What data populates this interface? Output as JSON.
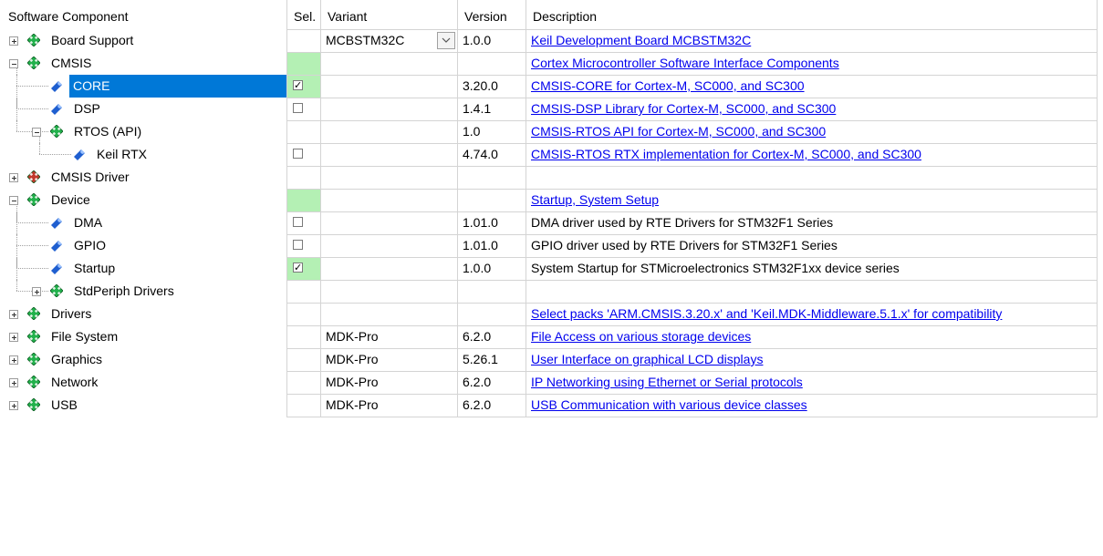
{
  "headers": {
    "component": "Software Component",
    "sel": "Sel.",
    "variant": "Variant",
    "version": "Version",
    "description": "Description"
  },
  "colors": {
    "selection": "#0078d7",
    "sel_highlight": "#b4f0b4",
    "link": "#0000ee",
    "diamond_ok": "#22b14c",
    "diamond_error": "#c0392b",
    "gem": "#1f5fd0"
  },
  "rows": [
    {
      "name": "Board Support",
      "level": 0,
      "expander": "plus",
      "icon": "green-diamond-icon",
      "checkbox": null,
      "sel_green": false,
      "variant": "MCBSTM32C",
      "variant_dropdown": true,
      "version": "1.0.0",
      "description": "Keil Development Board MCBSTM32C",
      "desc_link": true,
      "selected": false
    },
    {
      "name": "CMSIS",
      "level": 0,
      "expander": "minus",
      "icon": "green-diamond-icon",
      "checkbox": null,
      "sel_green": true,
      "variant": "",
      "variant_dropdown": false,
      "version": "",
      "description": "Cortex Microcontroller Software Interface Components",
      "desc_link": true,
      "selected": false
    },
    {
      "name": "CORE",
      "level": 1,
      "expander": "none",
      "icon": "blue-gem-icon",
      "checkbox": "checked",
      "sel_green": true,
      "variant": "",
      "variant_dropdown": false,
      "version": "3.20.0",
      "description": "CMSIS-CORE for Cortex-M, SC000, and SC300",
      "desc_link": true,
      "selected": true
    },
    {
      "name": "DSP",
      "level": 1,
      "expander": "none",
      "icon": "blue-gem-icon",
      "checkbox": "unchecked",
      "sel_green": false,
      "variant": "",
      "variant_dropdown": false,
      "version": "1.4.1",
      "description": "CMSIS-DSP Library for Cortex-M, SC000, and SC300",
      "desc_link": true,
      "selected": false
    },
    {
      "name": "RTOS (API)",
      "level": 1,
      "expander": "minus",
      "icon": "green-diamond-icon",
      "checkbox": null,
      "sel_green": false,
      "variant": "",
      "variant_dropdown": false,
      "version": "1.0",
      "description": "CMSIS-RTOS API for Cortex-M, SC000, and SC300",
      "desc_link": true,
      "selected": false
    },
    {
      "name": "Keil RTX",
      "level": 2,
      "expander": "none",
      "icon": "blue-gem-icon",
      "checkbox": "unchecked",
      "sel_green": false,
      "variant": "",
      "variant_dropdown": false,
      "version": "4.74.0",
      "description": "CMSIS-RTOS RTX implementation for Cortex-M, SC000, and SC300",
      "desc_link": true,
      "selected": false
    },
    {
      "name": "CMSIS Driver",
      "level": 0,
      "expander": "plus",
      "icon": "red-diamond-icon",
      "checkbox": null,
      "sel_green": false,
      "variant": "",
      "variant_dropdown": false,
      "version": "",
      "description": "",
      "desc_link": false,
      "selected": false
    },
    {
      "name": "Device",
      "level": 0,
      "expander": "minus",
      "icon": "green-diamond-icon",
      "checkbox": null,
      "sel_green": true,
      "variant": "",
      "variant_dropdown": false,
      "version": "",
      "description": "Startup, System Setup",
      "desc_link": true,
      "selected": false
    },
    {
      "name": "DMA",
      "level": 1,
      "expander": "none",
      "icon": "blue-gem-icon",
      "checkbox": "unchecked",
      "sel_green": false,
      "variant": "",
      "variant_dropdown": false,
      "version": "1.01.0",
      "description": "DMA driver used by RTE Drivers for STM32F1 Series",
      "desc_link": false,
      "selected": false
    },
    {
      "name": "GPIO",
      "level": 1,
      "expander": "none",
      "icon": "blue-gem-icon",
      "checkbox": "unchecked",
      "sel_green": false,
      "variant": "",
      "variant_dropdown": false,
      "version": "1.01.0",
      "description": "GPIO driver used by RTE Drivers for STM32F1 Series",
      "desc_link": false,
      "selected": false
    },
    {
      "name": "Startup",
      "level": 1,
      "expander": "none",
      "icon": "blue-gem-icon",
      "checkbox": "checked",
      "sel_green": true,
      "variant": "",
      "variant_dropdown": false,
      "version": "1.0.0",
      "description": "System Startup for STMicroelectronics STM32F1xx device series",
      "desc_link": false,
      "selected": false
    },
    {
      "name": "StdPeriph Drivers",
      "level": 1,
      "expander": "plus",
      "icon": "green-diamond-icon",
      "checkbox": null,
      "sel_green": false,
      "variant": "",
      "variant_dropdown": false,
      "version": "",
      "description": "",
      "desc_link": false,
      "selected": false
    },
    {
      "name": "Drivers",
      "level": 0,
      "expander": "plus",
      "icon": "green-diamond-icon",
      "checkbox": null,
      "sel_green": false,
      "variant": "",
      "variant_dropdown": false,
      "version": "",
      "description": "Select packs 'ARM.CMSIS.3.20.x' and 'Keil.MDK-Middleware.5.1.x' for compatibility",
      "desc_link": true,
      "selected": false
    },
    {
      "name": "File System",
      "level": 0,
      "expander": "plus",
      "icon": "green-diamond-icon",
      "checkbox": null,
      "sel_green": false,
      "variant": "MDK-Pro",
      "variant_dropdown": false,
      "version": "6.2.0",
      "description": "File Access on various storage devices",
      "desc_link": true,
      "selected": false
    },
    {
      "name": "Graphics",
      "level": 0,
      "expander": "plus",
      "icon": "green-diamond-icon",
      "checkbox": null,
      "sel_green": false,
      "variant": "MDK-Pro",
      "variant_dropdown": false,
      "version": "5.26.1",
      "description": "User Interface on graphical LCD displays",
      "desc_link": true,
      "selected": false
    },
    {
      "name": "Network",
      "level": 0,
      "expander": "plus",
      "icon": "green-diamond-icon",
      "checkbox": null,
      "sel_green": false,
      "variant": "MDK-Pro",
      "variant_dropdown": false,
      "version": "6.2.0",
      "description": "IP Networking using Ethernet or Serial protocols",
      "desc_link": true,
      "selected": false
    },
    {
      "name": "USB",
      "level": 0,
      "expander": "plus",
      "icon": "green-diamond-icon",
      "checkbox": null,
      "sel_green": false,
      "variant": "MDK-Pro",
      "variant_dropdown": false,
      "version": "6.2.0",
      "description": "USB Communication with various device classes",
      "desc_link": true,
      "selected": false
    }
  ]
}
